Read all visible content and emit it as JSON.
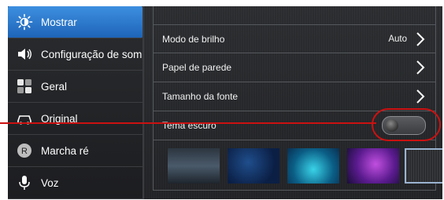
{
  "sidebar": {
    "items": [
      {
        "label": "Mostrar",
        "icon": "brightness-icon",
        "selected": true
      },
      {
        "label": "Configuração de som",
        "icon": "speaker-icon",
        "selected": false
      },
      {
        "label": "Geral",
        "icon": "grid-icon",
        "selected": false
      },
      {
        "label": "Original",
        "icon": "car-icon",
        "selected": false
      },
      {
        "label": "Marcha ré",
        "icon": "reverse-r-icon",
        "selected": false
      },
      {
        "label": "Voz",
        "icon": "microphone-icon",
        "selected": false
      }
    ]
  },
  "main": {
    "rows": [
      {
        "label": "Modo de brilho",
        "value": "Auto",
        "icon": "chevron-right-icon"
      },
      {
        "label": "Papel de parede",
        "icon": "chevron-right-icon"
      },
      {
        "label": "Tamanho da fonte",
        "icon": "chevron-right-icon"
      },
      {
        "label": "Tema escuro",
        "toggle": "off"
      }
    ],
    "wallpapers": [
      {
        "name": "dark-gradient"
      },
      {
        "name": "deep-blue"
      },
      {
        "name": "cyan-glow"
      },
      {
        "name": "purple-nebula"
      },
      {
        "name": "brushed-metal",
        "selected": true
      }
    ]
  },
  "colors": {
    "accent": "#2f7fd6",
    "annotation": "#cc1111",
    "text": "#ffffff"
  }
}
